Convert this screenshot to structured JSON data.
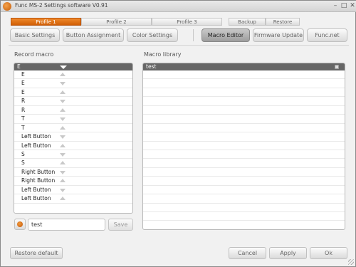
{
  "window": {
    "title": "Func MS-2 Settings software V0.91",
    "controls": [
      "–",
      "□",
      "✕"
    ]
  },
  "profiles": [
    {
      "label": "Profile 1",
      "active": true
    },
    {
      "label": "Profile 2",
      "active": false
    },
    {
      "label": "Profile 3",
      "active": false
    }
  ],
  "file_tabs": {
    "backup": "Backup",
    "restore": "Restore"
  },
  "nav": {
    "basic": "Basic Settings",
    "button_assignment": "Button Assignment",
    "color": "Color Settings",
    "macro_editor": "Macro Editor",
    "firmware": "Firmware Update",
    "funcnet": "Func.net",
    "active": "Macro Editor"
  },
  "record_macro": {
    "label": "Record macro",
    "rows": [
      {
        "key": "E",
        "dir": "down"
      },
      {
        "key": "E",
        "dir": "up"
      },
      {
        "key": "E",
        "dir": "down"
      },
      {
        "key": "E",
        "dir": "up"
      },
      {
        "key": "R",
        "dir": "down"
      },
      {
        "key": "R",
        "dir": "up"
      },
      {
        "key": "T",
        "dir": "down"
      },
      {
        "key": "T",
        "dir": "up"
      },
      {
        "key": "Left Button",
        "dir": "down"
      },
      {
        "key": "Left Button",
        "dir": "up"
      },
      {
        "key": "S",
        "dir": "down"
      },
      {
        "key": "S",
        "dir": "up"
      },
      {
        "key": "Right Button",
        "dir": "down"
      },
      {
        "key": "Right Button",
        "dir": "up"
      },
      {
        "key": "Left Button",
        "dir": "down"
      },
      {
        "key": "Left Button",
        "dir": "up"
      }
    ],
    "name_value": "test",
    "save_label": "Save"
  },
  "macro_library": {
    "label": "Macro library",
    "items": [
      "test"
    ]
  },
  "footer": {
    "restore_default": "Restore default",
    "cancel": "Cancel",
    "apply": "Apply",
    "ok": "Ok"
  },
  "colors": {
    "accent": "#e0701a",
    "active_nav": "#b0b0b0",
    "list_header": "#666666"
  }
}
